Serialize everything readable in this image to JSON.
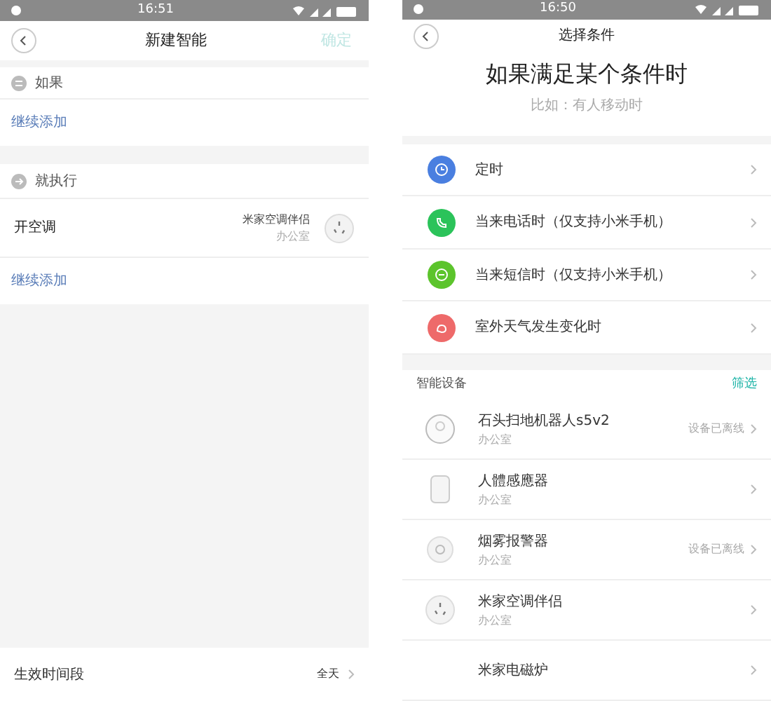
{
  "left": {
    "status_bar": {
      "time": "16:51"
    },
    "header": {
      "title": "新建智能",
      "confirm": "确定",
      "confirm_disabled": true
    },
    "if_section": {
      "label": "如果",
      "add": "继续添加"
    },
    "then_section": {
      "label": "就执行",
      "actions": [
        {
          "name": "开空调",
          "device": "米家空调伴侣",
          "room": "办公室"
        }
      ],
      "add": "继续添加"
    },
    "footer": {
      "label": "生效时间段",
      "value": "全天"
    }
  },
  "right": {
    "status_bar": {
      "time": "16:50"
    },
    "header": {
      "title": "选择条件"
    },
    "heading": "如果满足某个条件时",
    "subheading": "比如：有人移动时",
    "conditions": [
      {
        "label": "定时",
        "color": "#4a7fe0",
        "kind": "clock"
      },
      {
        "label": "当来电话时（仅支持小米手机）",
        "color": "#2bc35a",
        "kind": "phone"
      },
      {
        "label": "当来短信时（仅支持小米手机）",
        "color": "#5cc42c",
        "kind": "message"
      },
      {
        "label": "室外天气发生变化时",
        "color": "#ee6a6a",
        "kind": "weather"
      }
    ],
    "devices_title": "智能设备",
    "filter": "筛选",
    "devices": [
      {
        "name": "石头扫地机器人s5v2",
        "room": "办公室",
        "status": "设备已离线",
        "kind": "robot"
      },
      {
        "name": "人體感應器",
        "room": "办公室",
        "kind": "sensor"
      },
      {
        "name": "烟雾报警器",
        "room": "办公室",
        "status": "设备已离线",
        "kind": "smoke"
      },
      {
        "name": "米家空调伴侣",
        "room": "办公室",
        "kind": "plug"
      },
      {
        "name": "米家电磁炉",
        "kind": "none"
      }
    ]
  }
}
